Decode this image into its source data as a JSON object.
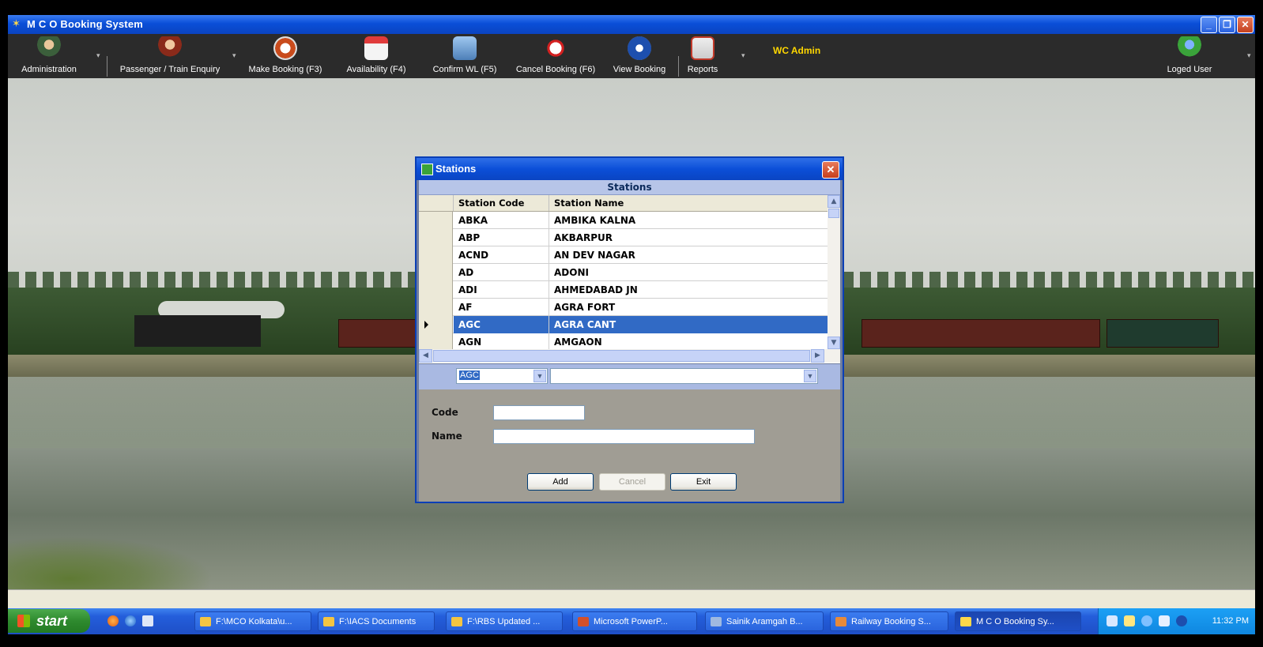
{
  "window": {
    "title": "M C O Booking System"
  },
  "toolbar": {
    "items": [
      {
        "label": "Administration",
        "icon": "admin-user-icon"
      },
      {
        "label": "Passenger / Train Enquiry",
        "icon": "agent-icon"
      },
      {
        "label": "Make Booking (F3)",
        "icon": "booking-icon"
      },
      {
        "label": "Availability (F4)",
        "icon": "calendar-icon"
      },
      {
        "label": "Confirm WL (F5)",
        "icon": "confirm-icon"
      },
      {
        "label": "Cancel Booking (F6)",
        "icon": "cancel-icon"
      },
      {
        "label": "View Booking",
        "icon": "checkbox-icon"
      },
      {
        "label": "Reports",
        "icon": "clipboard-icon"
      }
    ],
    "role": "WC Admin",
    "user_label": "Loged User"
  },
  "dialog": {
    "title": "Stations",
    "grid_caption": "Stations",
    "columns": [
      "Station Code",
      "Station Name"
    ],
    "rows": [
      {
        "code": "ABKA",
        "name": "AMBIKA KALNA"
      },
      {
        "code": "ABP",
        "name": "AKBARPUR"
      },
      {
        "code": "ACND",
        "name": "AN DEV NAGAR"
      },
      {
        "code": "AD",
        "name": "ADONI"
      },
      {
        "code": "ADI",
        "name": "AHMEDABAD JN"
      },
      {
        "code": "AF",
        "name": "AGRA FORT"
      },
      {
        "code": "AGC",
        "name": "AGRA CANT"
      },
      {
        "code": "AGN",
        "name": "AMGAON"
      }
    ],
    "selected_row": "AGC",
    "filter": {
      "code_value": "AGC",
      "name_value": ""
    },
    "form": {
      "code_label": "Code",
      "name_label": "Name",
      "code_value": "",
      "name_value": ""
    },
    "buttons": {
      "add": "Add",
      "cancel": "Cancel",
      "exit": "Exit"
    }
  },
  "taskbar": {
    "start_label": "start",
    "tasks": [
      "F:\\MCO Kolkata\\u...",
      "F:\\IACS Documents",
      "F:\\RBS Updated ...",
      "Microsoft PowerP...",
      "Sainik Aramgah B...",
      "Railway Booking S...",
      "M C O Booking Sy..."
    ],
    "active_task": "M C O Booking Sy...",
    "clock": "11:32 PM"
  },
  "colors": {
    "titlebar": "#0a4fd8",
    "toolbar_bg": "#2b2b2b",
    "role_text": "#ffd700",
    "selection": "#316ac5",
    "taskbar": "#245edb",
    "start_button": "#2e8a2e"
  }
}
